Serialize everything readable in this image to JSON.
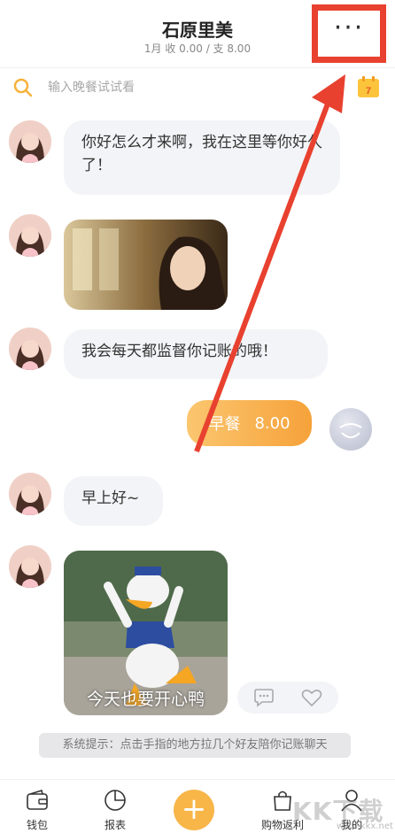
{
  "header": {
    "title": "石原里美",
    "subtitle": "1月 收 0.00 / 支 8.00",
    "more_label": "···"
  },
  "search": {
    "placeholder": "输入晚餐试试看",
    "calendar_day": "7"
  },
  "messages": [
    {
      "side": "left",
      "type": "text",
      "text": "你好怎么才来啊，我在这里等你好久了！"
    },
    {
      "side": "left",
      "type": "image",
      "description_icon": "girl-photo"
    },
    {
      "side": "left",
      "type": "text",
      "text": "我会每天都监督你记账的哦！"
    },
    {
      "side": "right",
      "type": "record",
      "category": "早餐",
      "amount": "8.00"
    },
    {
      "side": "left",
      "type": "text",
      "text": "早上好~"
    },
    {
      "side": "left",
      "type": "image",
      "caption": "今天也要开心鸭"
    }
  ],
  "system_tip": "系统提示：点击手指的地方拉几个好友陪你记账聊天",
  "tabbar": {
    "items": [
      {
        "label": "钱包",
        "icon": "wallet-icon"
      },
      {
        "label": "报表",
        "icon": "pie-chart-icon"
      },
      {
        "label": "+",
        "icon": "add-icon"
      },
      {
        "label": "购物返利",
        "icon": "shopping-bag-icon"
      },
      {
        "label": "我的",
        "icon": "user-icon"
      }
    ]
  },
  "watermark": {
    "big": "KK下载",
    "small": "www.kkx.net"
  },
  "colors": {
    "accent": "#f8b548",
    "highlight_red": "#e8412f",
    "bubble_bg": "#f3f4f7"
  }
}
